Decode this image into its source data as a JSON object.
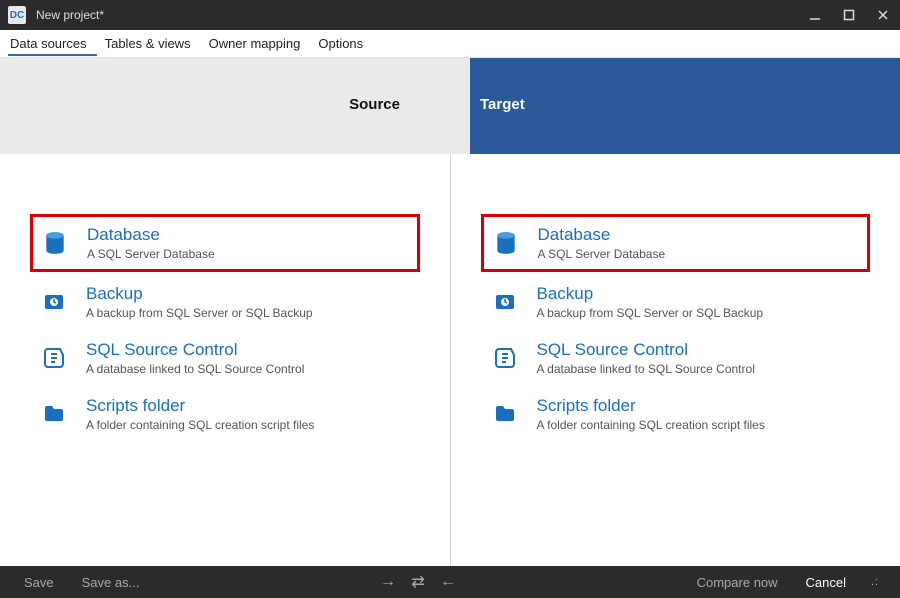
{
  "window": {
    "title": "New project*"
  },
  "tabs": {
    "data_sources": "Data sources",
    "tables_views": "Tables & views",
    "owner_mapping": "Owner mapping",
    "options": "Options"
  },
  "chevron": {
    "source": "Source",
    "target": "Target"
  },
  "options": {
    "database": {
      "title": "Database",
      "desc": "A SQL Server Database"
    },
    "backup": {
      "title": "Backup",
      "desc": "A backup from SQL Server or SQL Backup"
    },
    "source_control": {
      "title": "SQL Source Control",
      "desc": "A database linked to SQL Source Control"
    },
    "scripts_folder": {
      "title": "Scripts folder",
      "desc": "A folder containing SQL creation script files"
    }
  },
  "bottom": {
    "save": "Save",
    "save_as": "Save as...",
    "compare": "Compare now",
    "cancel": "Cancel"
  }
}
